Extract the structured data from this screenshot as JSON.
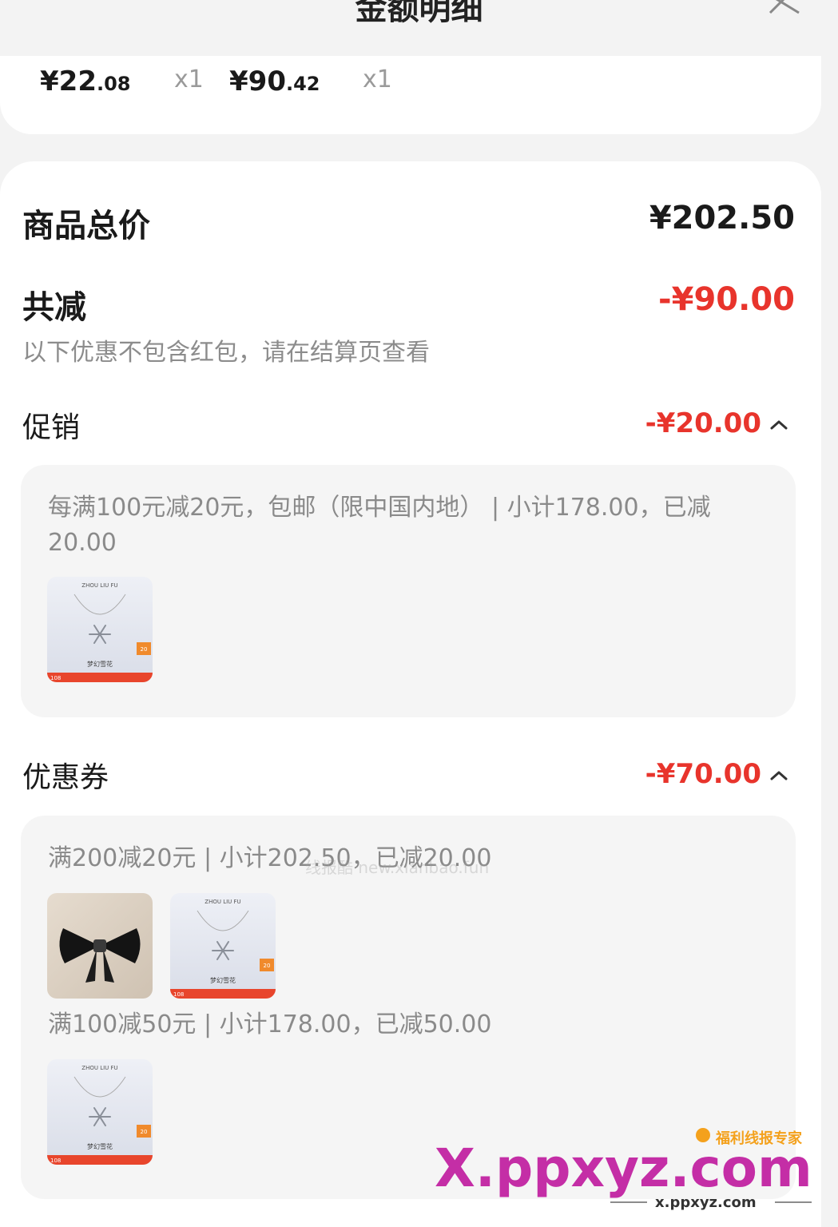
{
  "header": {
    "title": "金额明细"
  },
  "top_items": [
    {
      "price_int": "¥22",
      "price_dec": ".08",
      "qty": "x1"
    },
    {
      "price_int": "¥90",
      "price_dec": ".42",
      "qty": "x1"
    }
  ],
  "summary": {
    "total_label": "商品总价",
    "total_amount": "¥202.50",
    "discount_label": "共减",
    "discount_amount": "-¥90.00",
    "note": "以下优惠不包含红包，请在结算页查看"
  },
  "promotion": {
    "label": "促销",
    "amount": "-¥20.00",
    "rule": "每满100元减20元，包邮（限中国内地） | 小计178.00，已减20.00"
  },
  "coupons": {
    "label": "优惠券",
    "amount": "-¥70.00",
    "items": [
      {
        "rule": "满200减20元 | 小计202.50，已减20.00"
      },
      {
        "rule": "满100减50元 | 小计178.00，已减50.00"
      }
    ]
  },
  "product_thumb": {
    "brand": "ZHOU LIU FU",
    "name": "梦幻雪花",
    "badge": "20",
    "tag": "108"
  },
  "watermark": {
    "text": "线报酷 new.xianbao.fun",
    "logo_tagline": "福利线报专家",
    "logo_main": "X.ppxyz.com",
    "logo_sub": "x.ppxyz.com"
  },
  "colors": {
    "accent_red": "#e8342c",
    "muted": "#8c8c8c"
  }
}
